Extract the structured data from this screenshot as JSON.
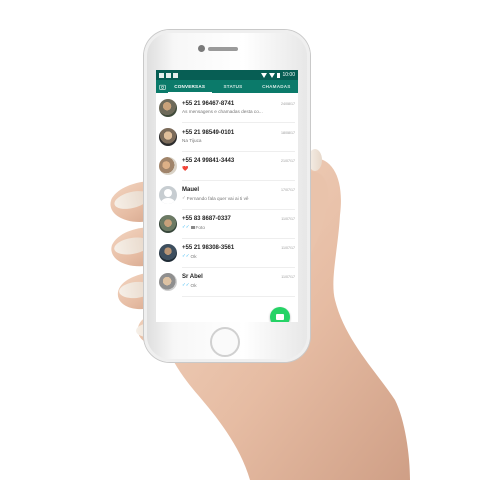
{
  "statusbar": {
    "time": "10:00",
    "notification_icons": [
      "facebook-icon",
      "gallery-icon",
      "tools-icon"
    ],
    "status_icons": [
      "wifi-icon",
      "signal-icon",
      "battery-icon"
    ]
  },
  "tabs": {
    "camera_icon": "camera-icon",
    "items": [
      {
        "label": "CONVERSAS",
        "active": true
      },
      {
        "label": "STATUS",
        "active": false
      },
      {
        "label": "CHAMADAS",
        "active": false
      }
    ]
  },
  "chats": [
    {
      "name": "+55 21 96467-8741",
      "time": "24/08/17",
      "message": "As mensagens e chamadas desta co...",
      "tick": "",
      "avatar": "photo1"
    },
    {
      "name": "+55 21 98549-0101",
      "time": "18/08/17",
      "message": "Na Tijuca",
      "tick": "",
      "avatar": "photo2"
    },
    {
      "name": "+55 24 99841-3443",
      "time": "21/07/17",
      "message": "❤️",
      "tick": "",
      "avatar": "photo3"
    },
    {
      "name": "Mauel",
      "time": "17/07/17",
      "message": "Fernando fala quer vai ai ti vê",
      "tick": "✓",
      "avatar": "gray"
    },
    {
      "name": "+55 83 8687-0337",
      "time": "11/07/17",
      "message": "Foto",
      "tick": "✓✓",
      "avatar": "photo4"
    },
    {
      "name": "+55 21 98308-3561",
      "time": "11/07/17",
      "message": "Ok",
      "tick": "✓✓",
      "avatar": "photo5"
    },
    {
      "name": "Sr Abel",
      "time": "11/07/17",
      "message": "Ok",
      "tick": "✓✓",
      "avatar": "photo6"
    }
  ],
  "fab": {
    "icon": "new-chat-icon",
    "color": "#25d366"
  },
  "navbar": {
    "icons": [
      "back-icon",
      "home-icon",
      "recent-apps-icon"
    ]
  },
  "colors": {
    "header": "#075e54",
    "tabs": "#0b7a6a",
    "accent": "#25d366",
    "read_tick": "#34b7f1"
  }
}
